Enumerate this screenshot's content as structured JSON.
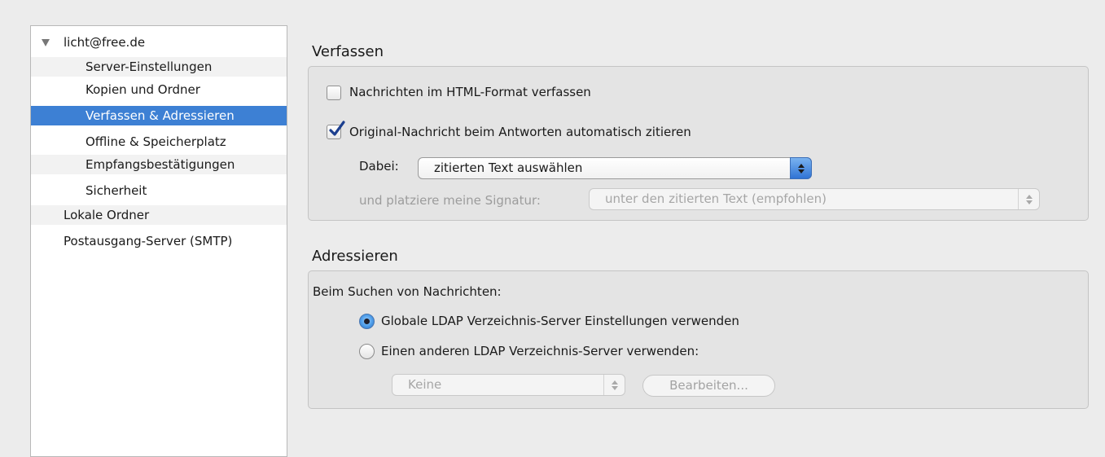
{
  "sidebar": {
    "items": [
      {
        "label": "licht@free.de",
        "level": 0,
        "expanded": true
      },
      {
        "label": "Server-Einstellungen",
        "level": 1
      },
      {
        "label": "Kopien und Ordner",
        "level": 1
      },
      {
        "label": "Verfassen & Adressieren",
        "level": 1,
        "selected": true
      },
      {
        "label": "Offline & Speicherplatz",
        "level": 1
      },
      {
        "label": "Empfangsbestätigungen",
        "level": 1
      },
      {
        "label": "Sicherheit",
        "level": 1
      },
      {
        "label": "Lokale Ordner",
        "level": 0
      },
      {
        "label": "Postausgang-Server (SMTP)",
        "level": 0
      }
    ]
  },
  "compose": {
    "title": "Verfassen",
    "html_checkbox": {
      "label": "Nachrichten im HTML-Format verfassen",
      "checked": false
    },
    "quote_checkbox": {
      "label": "Original-Nachricht beim Antworten automatisch zitieren",
      "checked": true
    },
    "dabei_label": "Dabei:",
    "dabei_value": "zitierten Text auswählen",
    "signature_label": "und platziere meine Signatur:",
    "signature_value": "unter den zitierten Text (empfohlen)"
  },
  "addressing": {
    "title": "Adressieren",
    "search_label": "Beim Suchen von Nachrichten:",
    "radio_global": {
      "label": "Globale LDAP Verzeichnis-Server Einstellungen verwenden",
      "selected": true
    },
    "radio_other": {
      "label": "Einen anderen LDAP Verzeichnis-Server verwenden:",
      "selected": false
    },
    "server_value": "Keine",
    "edit_button": "Bearbeiten..."
  },
  "colors": {
    "selection": "#3d80d4",
    "checkbox_check": "#1c3f8f",
    "radio_selected": "#4d9ce8"
  }
}
